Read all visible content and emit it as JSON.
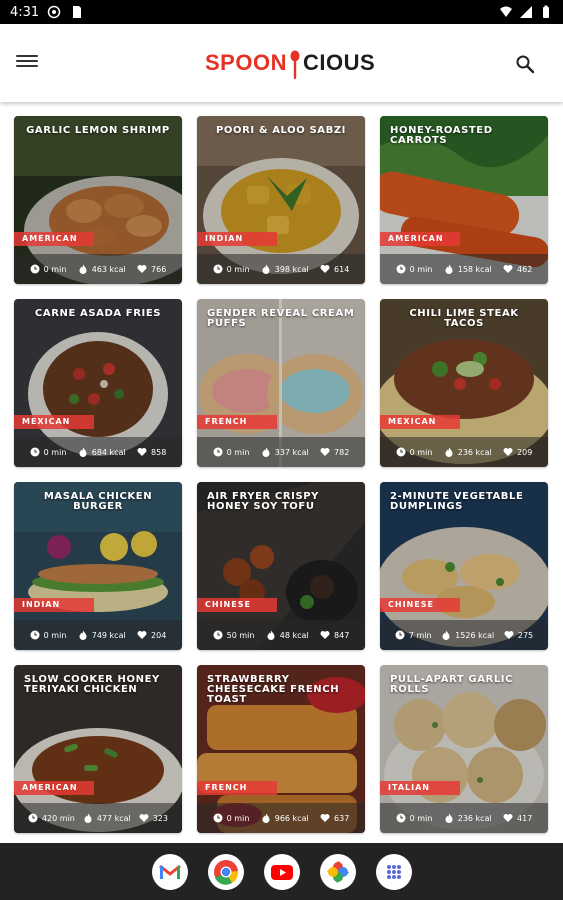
{
  "status_bar": {
    "time": "4:31"
  },
  "app": {
    "logo_left": "SPOON",
    "logo_right": "CIOUS",
    "brand_color": "#e53224"
  },
  "recipes": [
    {
      "title": "GARLIC LEMON SHRIMP",
      "cuisine": "AMERICAN",
      "time": "0 min",
      "kcal": "463 kcal",
      "likes": "766"
    },
    {
      "title": "POORI & ALOO SABZI",
      "cuisine": "INDIAN",
      "time": "0 min",
      "kcal": "398 kcal",
      "likes": "614"
    },
    {
      "title": "HONEY-ROASTED CARROTS",
      "cuisine": "AMERICAN",
      "time": "0 min",
      "kcal": "158 kcal",
      "likes": "462"
    },
    {
      "title": "CARNE ASADA FRIES",
      "cuisine": "MEXICAN",
      "time": "0 min",
      "kcal": "684 kcal",
      "likes": "858"
    },
    {
      "title": "GENDER REVEAL CREAM PUFFS",
      "cuisine": "FRENCH",
      "time": "0 min",
      "kcal": "337 kcal",
      "likes": "782"
    },
    {
      "title": "CHILI LIME STEAK TACOS",
      "cuisine": "MEXICAN",
      "time": "0 min",
      "kcal": "236 kcal",
      "likes": "209"
    },
    {
      "title": "MASALA CHICKEN BURGER",
      "cuisine": "INDIAN",
      "time": "0 min",
      "kcal": "749 kcal",
      "likes": "204"
    },
    {
      "title": "AIR FRYER CRISPY HONEY SOY TOFU",
      "cuisine": "CHINESE",
      "time": "50 min",
      "kcal": "48 kcal",
      "likes": "847"
    },
    {
      "title": "2-MINUTE VEGETABLE DUMPLINGS",
      "cuisine": "CHINESE",
      "time": "7 min",
      "kcal": "1526 kcal",
      "likes": "275"
    },
    {
      "title": "SLOW COOKER HONEY TERIYAKI CHICKEN",
      "cuisine": "AMERICAN",
      "time": "420 min",
      "kcal": "477 kcal",
      "likes": "323"
    },
    {
      "title": "STRAWBERRY CHEESECAKE FRENCH TOAST",
      "cuisine": "FRENCH",
      "time": "0 min",
      "kcal": "966 kcal",
      "likes": "637"
    },
    {
      "title": "PULL-APART GARLIC ROLLS",
      "cuisine": "ITALIAN",
      "time": "0 min",
      "kcal": "236 kcal",
      "likes": "417"
    }
  ],
  "dock": [
    "gmail-icon",
    "chrome-icon",
    "youtube-icon",
    "photos-icon",
    "app-drawer-icon"
  ]
}
